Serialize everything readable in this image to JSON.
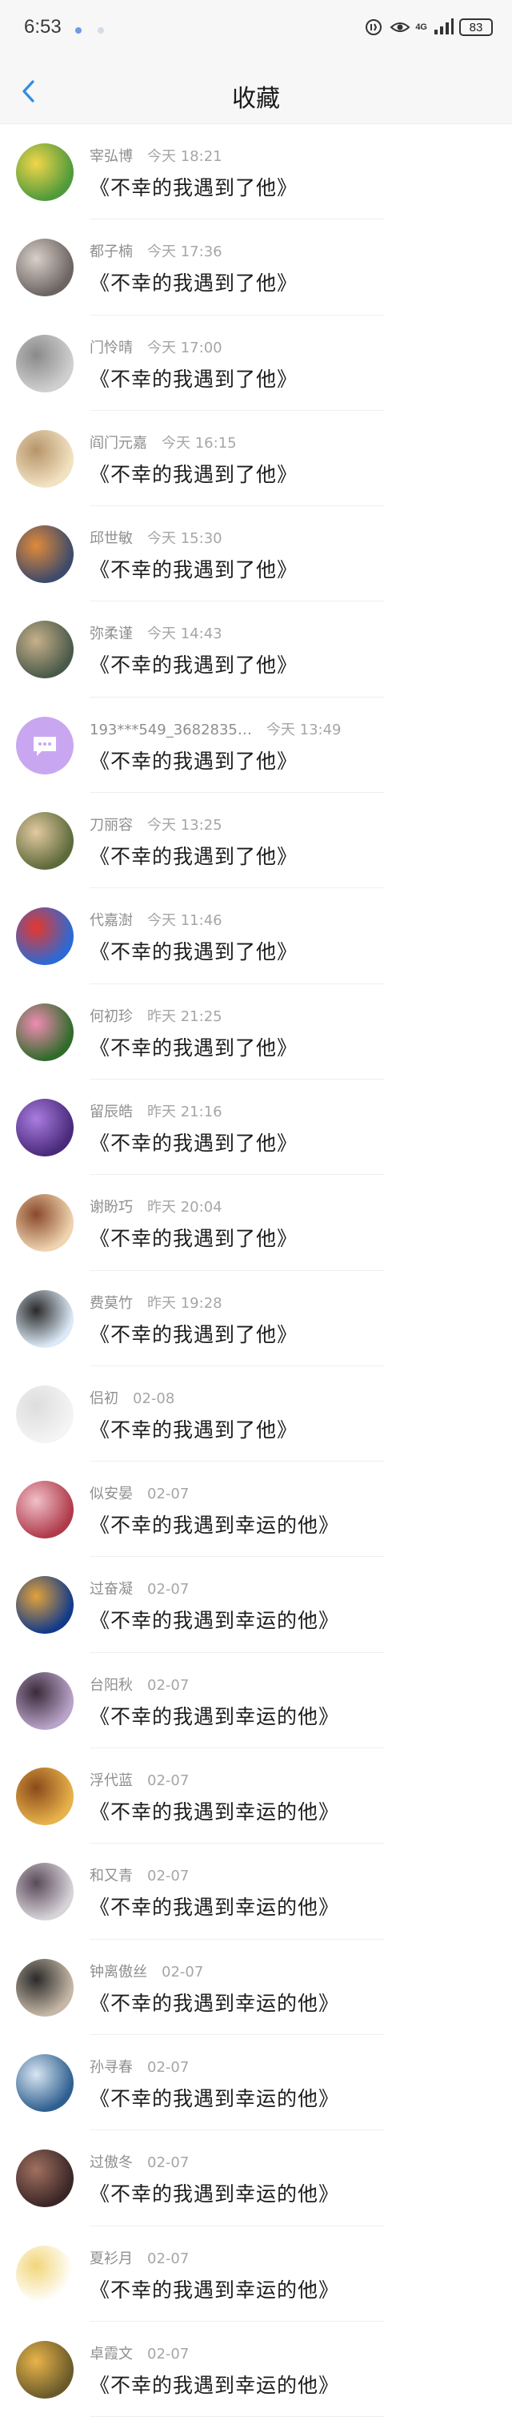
{
  "status_bar": {
    "time": "6:53",
    "network": "4G",
    "battery": "83",
    "icons": [
      "notification-dot-icon",
      "notification-dot-faint-icon",
      "data-saver-icon",
      "eye-icon",
      "signal-icon",
      "battery-icon"
    ]
  },
  "header": {
    "title": "收藏",
    "back_icon": "chevron-left-icon"
  },
  "favorites": [
    {
      "name": "宰弘博",
      "time": "今天 18:21",
      "message": "《不幸的我遇到了他》",
      "avatar_color": "#4f9a3b",
      "avatar_alt": "#f1d64a"
    },
    {
      "name": "都子楠",
      "time": "今天 17:36",
      "message": "《不幸的我遇到了他》",
      "avatar_color": "#6c6461",
      "avatar_alt": "#d9cfc9"
    },
    {
      "name": "门怜晴",
      "time": "今天 17:00",
      "message": "《不幸的我遇到了他》",
      "avatar_color": "#cfcfcf",
      "avatar_alt": "#8a8a8a"
    },
    {
      "name": "阎门元嘉",
      "time": "今天 16:15",
      "message": "《不幸的我遇到了他》",
      "avatar_color": "#f3e2c2",
      "avatar_alt": "#b6956a"
    },
    {
      "name": "邱世敏",
      "time": "今天 15:30",
      "message": "《不幸的我遇到了他》",
      "avatar_color": "#3d4a6a",
      "avatar_alt": "#e08a3a"
    },
    {
      "name": "弥柔谨",
      "time": "今天 14:43",
      "message": "《不幸的我遇到了他》",
      "avatar_color": "#4a5a4a",
      "avatar_alt": "#c7b08a"
    },
    {
      "name": "193***549_3682835…",
      "time": "今天 13:49",
      "message": "《不幸的我遇到了他》",
      "avatar_color": "#c9a7f0",
      "avatar_alt": "#ffffff"
    },
    {
      "name": "刀丽容",
      "time": "今天 13:25",
      "message": "《不幸的我遇到了他》",
      "avatar_color": "#5d6a3a",
      "avatar_alt": "#e3c9a2"
    },
    {
      "name": "代嘉澍",
      "time": "今天 11:46",
      "message": "《不幸的我遇到了他》",
      "avatar_color": "#2a6ad6",
      "avatar_alt": "#e6372e"
    },
    {
      "name": "何初珍",
      "time": "昨天 21:25",
      "message": "《不幸的我遇到了他》",
      "avatar_color": "#2f6b2a",
      "avatar_alt": "#f08bb2"
    },
    {
      "name": "留辰皓",
      "time": "昨天 21:16",
      "message": "《不幸的我遇到了他》",
      "avatar_color": "#4a2a7a",
      "avatar_alt": "#a97ce0"
    },
    {
      "name": "谢盼巧",
      "time": "昨天 20:04",
      "message": "《不幸的我遇到了他》",
      "avatar_color": "#f0d4b0",
      "avatar_alt": "#8a4a2a"
    },
    {
      "name": "费莫竹",
      "time": "昨天 19:28",
      "message": "《不幸的我遇到了他》",
      "avatar_color": "#dceaf7",
      "avatar_alt": "#2a2a2a"
    },
    {
      "name": "侣初",
      "time": "02-08",
      "message": "《不幸的我遇到了他》",
      "avatar_color": "#f4f4f4",
      "avatar_alt": "#dddddd"
    },
    {
      "name": "似安晏",
      "time": "02-07",
      "message": "《不幸的我遇到幸运的他》",
      "avatar_color": "#b03a4a",
      "avatar_alt": "#f0c0c8"
    },
    {
      "name": "过奋凝",
      "time": "02-07",
      "message": "《不幸的我遇到幸运的他》",
      "avatar_color": "#123a8a",
      "avatar_alt": "#e2a23a"
    },
    {
      "name": "台阳秋",
      "time": "02-07",
      "message": "《不幸的我遇到幸运的他》",
      "avatar_color": "#b9a3c9",
      "avatar_alt": "#3a2a3a"
    },
    {
      "name": "浮代蓝",
      "time": "02-07",
      "message": "《不幸的我遇到幸运的他》",
      "avatar_color": "#e8b24a",
      "avatar_alt": "#8a4a1a"
    },
    {
      "name": "和又青",
      "time": "02-07",
      "message": "《不幸的我遇到幸运的他》",
      "avatar_color": "#d8d3d9",
      "avatar_alt": "#5a4a5a"
    },
    {
      "name": "钟离傲丝",
      "time": "02-07",
      "message": "《不幸的我遇到幸运的他》",
      "avatar_color": "#c6b8a6",
      "avatar_alt": "#2a2a2a"
    },
    {
      "name": "孙寻春",
      "time": "02-07",
      "message": "《不幸的我遇到幸运的他》",
      "avatar_color": "#2f5f8f",
      "avatar_alt": "#d8e6f2"
    },
    {
      "name": "过傲冬",
      "time": "02-07",
      "message": "《不幸的我遇到幸运的他》",
      "avatar_color": "#3a2626",
      "avatar_alt": "#a07060"
    },
    {
      "name": "夏衫月",
      "time": "02-07",
      "message": "《不幸的我遇到幸运的他》",
      "avatar_color": "#ffffff",
      "avatar_alt": "#f2d67a"
    },
    {
      "name": "卓霞文",
      "time": "02-07",
      "message": "《不幸的我遇到幸运的他》",
      "avatar_color": "#6a5a2a",
      "avatar_alt": "#e8b44a"
    }
  ]
}
